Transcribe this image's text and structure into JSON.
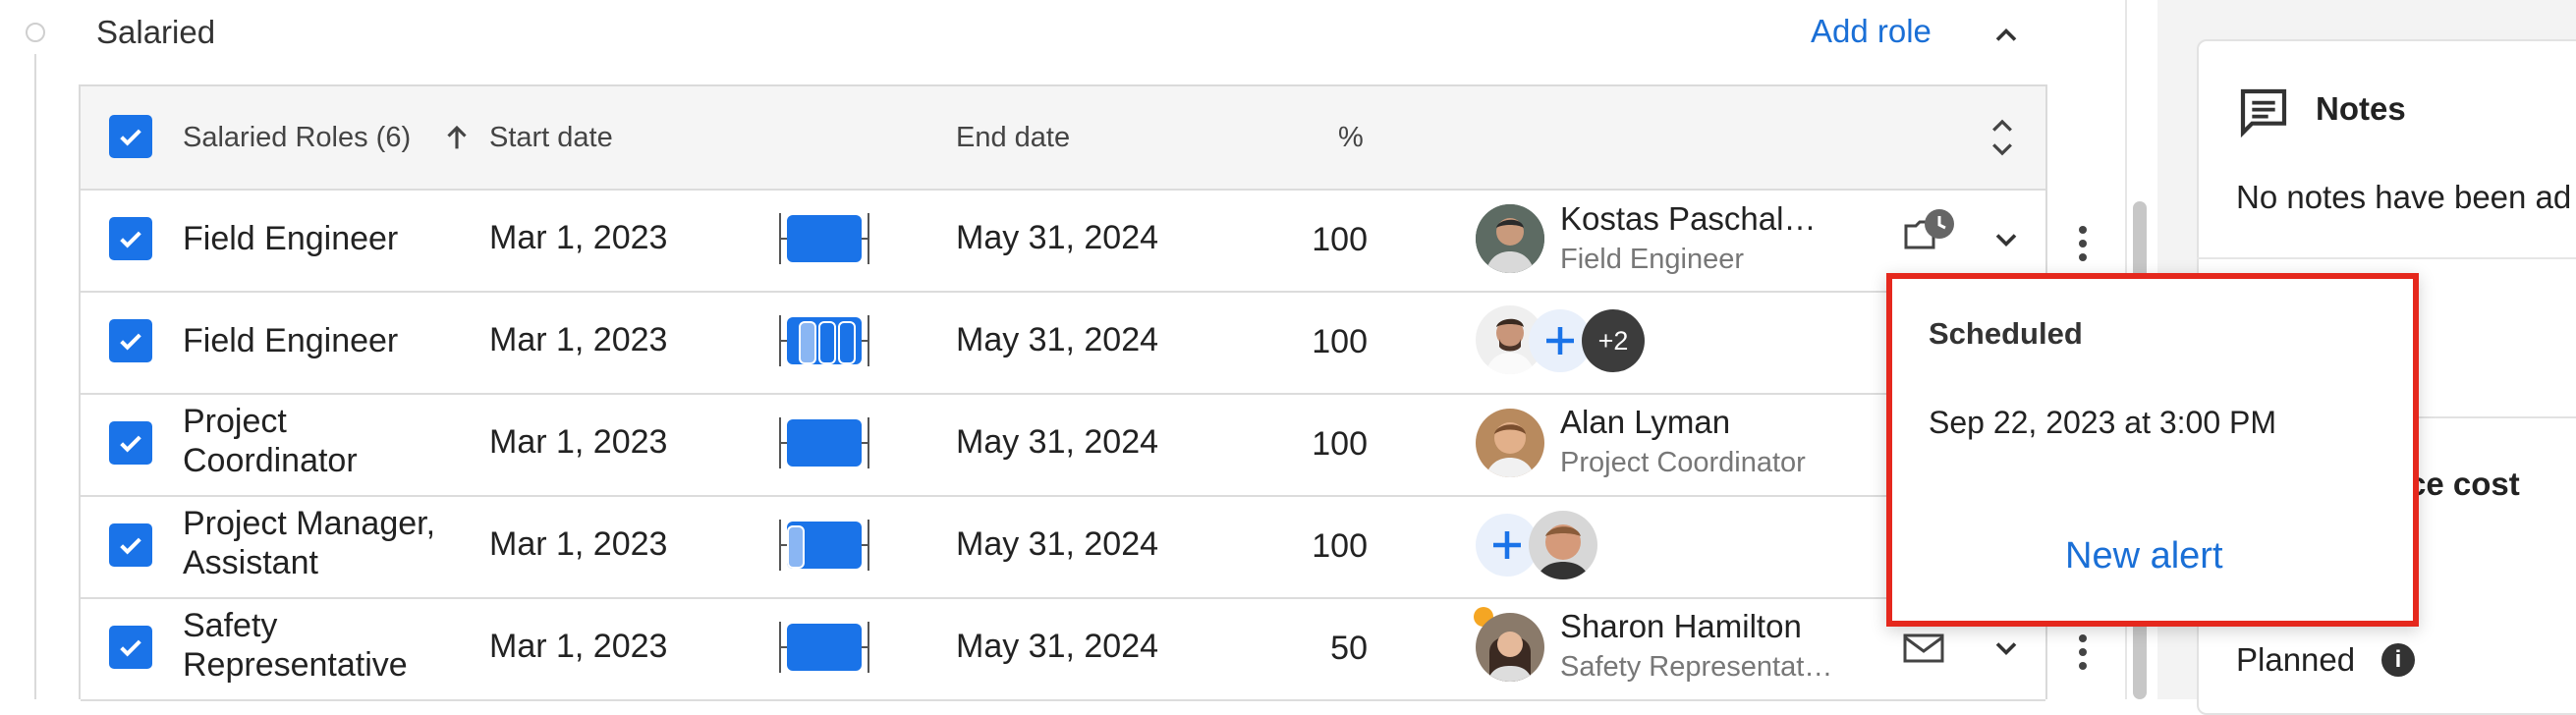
{
  "section": {
    "title": "Salaried",
    "add_role": "Add role"
  },
  "table": {
    "headers": {
      "roles": "Salaried Roles (6)",
      "start": "Start date",
      "end": "End date",
      "pct": "%"
    },
    "rows": [
      {
        "role": "Field Engineer",
        "start": "Mar 1, 2023",
        "end": "May 31, 2024",
        "pct": "100",
        "person_name": "Kostas Paschal…",
        "person_role": "Field Engineer"
      },
      {
        "role": "Field Engineer",
        "start": "Mar 1, 2023",
        "end": "May 31, 2024",
        "pct": "100",
        "extra_count": "+2"
      },
      {
        "role_line1": "Project",
        "role_line2": "Coordinator",
        "start": "Mar 1, 2023",
        "end": "May 31, 2024",
        "pct": "100",
        "person_name": "Alan Lyman",
        "person_role": "Project Coordinator"
      },
      {
        "role_line1": "Project Manager,",
        "role_line2": "Assistant",
        "start": "Mar 1, 2023",
        "end": "May 31, 2024",
        "pct": "100"
      },
      {
        "role_line1": "Safety",
        "role_line2": "Representative",
        "start": "Mar 1, 2023",
        "end": "May 31, 2024",
        "pct": "50",
        "person_name": "Sharon Hamilton",
        "person_role": "Safety Representat…"
      }
    ]
  },
  "notes": {
    "title": "Notes",
    "empty_text": "No notes have been ad"
  },
  "right": {
    "force_cost": "orce cost",
    "planned": "Planned"
  },
  "popover": {
    "title": "Scheduled",
    "datetime": "Sep 22, 2023 at 3:00 PM",
    "action": "New alert"
  },
  "colors": {
    "accent": "#1a73e8",
    "link": "#1a6fd6",
    "highlight_border": "#e5281d"
  }
}
